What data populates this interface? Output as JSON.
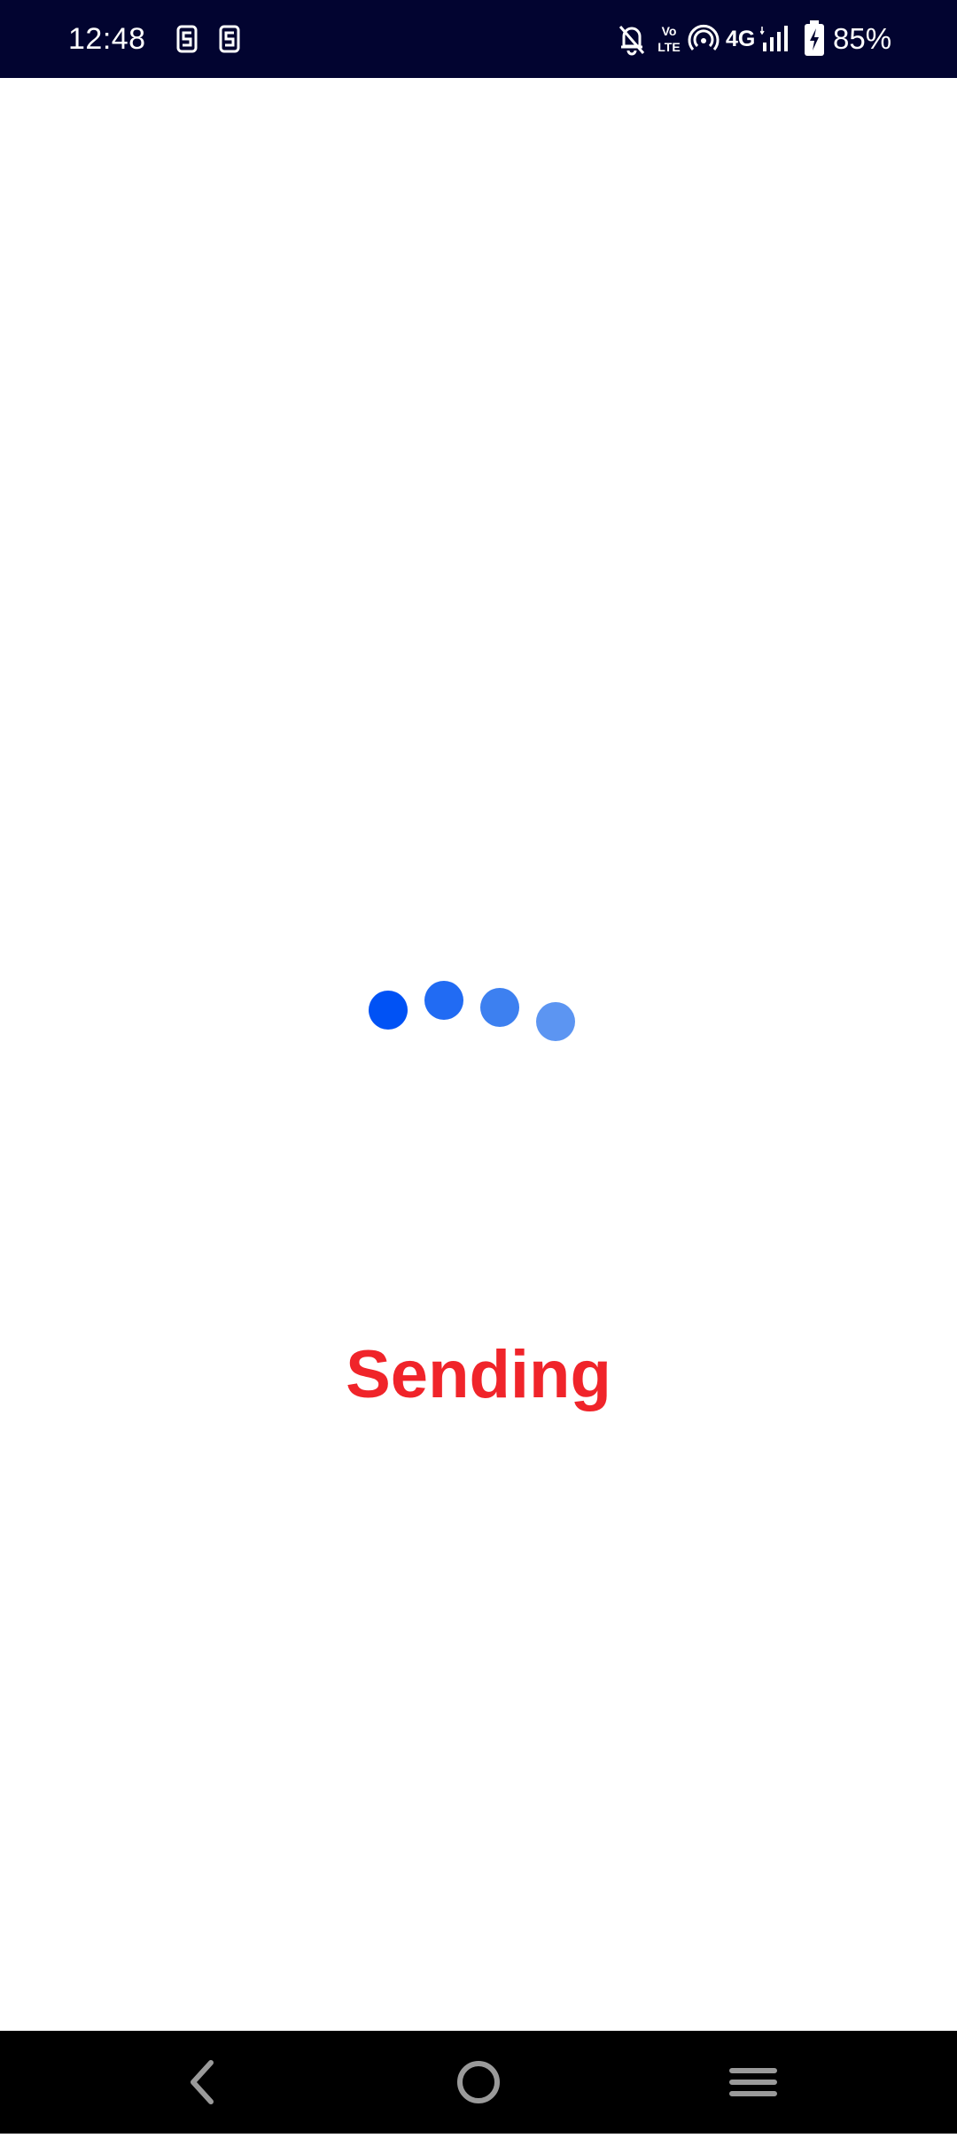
{
  "status_bar": {
    "time": "12:48",
    "left_icons": [
      "notification-s-icon",
      "notification-s-icon"
    ],
    "network_type": "4G",
    "battery_percent": "85%",
    "right_icons": [
      "bell-muted-icon",
      "volte-icon",
      "hotspot-icon",
      "signal-icon",
      "battery-charging-icon"
    ]
  },
  "screen": {
    "status_text": "Sending",
    "loader_dot_colors": [
      "#0052f5",
      "#216bf3",
      "#3d80f0",
      "#5c95f2"
    ]
  },
  "nav_bar": {
    "buttons": [
      "back-button",
      "home-button",
      "recents-button"
    ]
  },
  "colors": {
    "status_bar_bg": "#020430",
    "accent_text": "#f0242a",
    "nav_bar_bg": "#000000"
  }
}
